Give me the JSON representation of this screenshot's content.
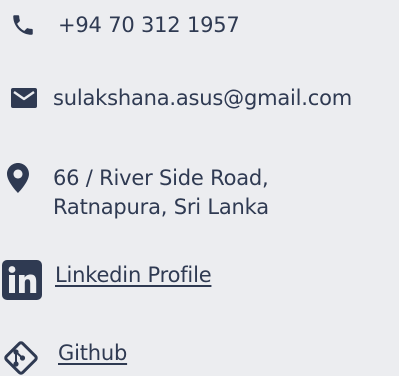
{
  "contact": {
    "phone": {
      "icon": "phone-icon",
      "text": "+94 70 312 1957"
    },
    "email": {
      "icon": "envelope-icon",
      "text": "sulakshana.asus@gmail.com"
    },
    "address": {
      "icon": "map-marker-icon",
      "line1": "66 / River Side Road,",
      "line2": "Ratnapura, Sri Lanka"
    },
    "linkedin": {
      "icon": "linkedin-icon",
      "text": "Linkedin Profile"
    },
    "github": {
      "icon": "git-icon",
      "text": "Github"
    }
  },
  "colors": {
    "background": "#ecedf0",
    "text": "#2f3a52"
  }
}
